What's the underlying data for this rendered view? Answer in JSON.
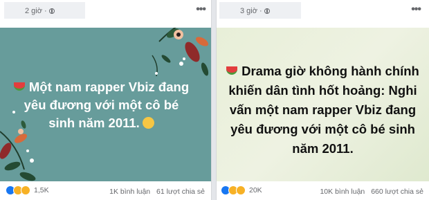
{
  "posts": [
    {
      "time": "2 giờ",
      "text": "Một nam rapper Vbiz đang yêu đương với một cô bé sinh năm 2011.",
      "reaction_count": "1,5K",
      "comments": "1K bình luận",
      "shares": "61 lượt chia sẻ",
      "card_color": "#679c9b"
    },
    {
      "time": "3 giờ",
      "text": "Drama giờ không hành chính khiến dân tình hốt hoảng: Nghi vấn một nam rapper Vbiz đang yêu đương với một cô bé sinh năm 2011.",
      "reaction_count": "20K",
      "comments": "10K bình luận",
      "shares": "660 lượt chia sẻ",
      "card_color": "#e8efd8"
    }
  ]
}
